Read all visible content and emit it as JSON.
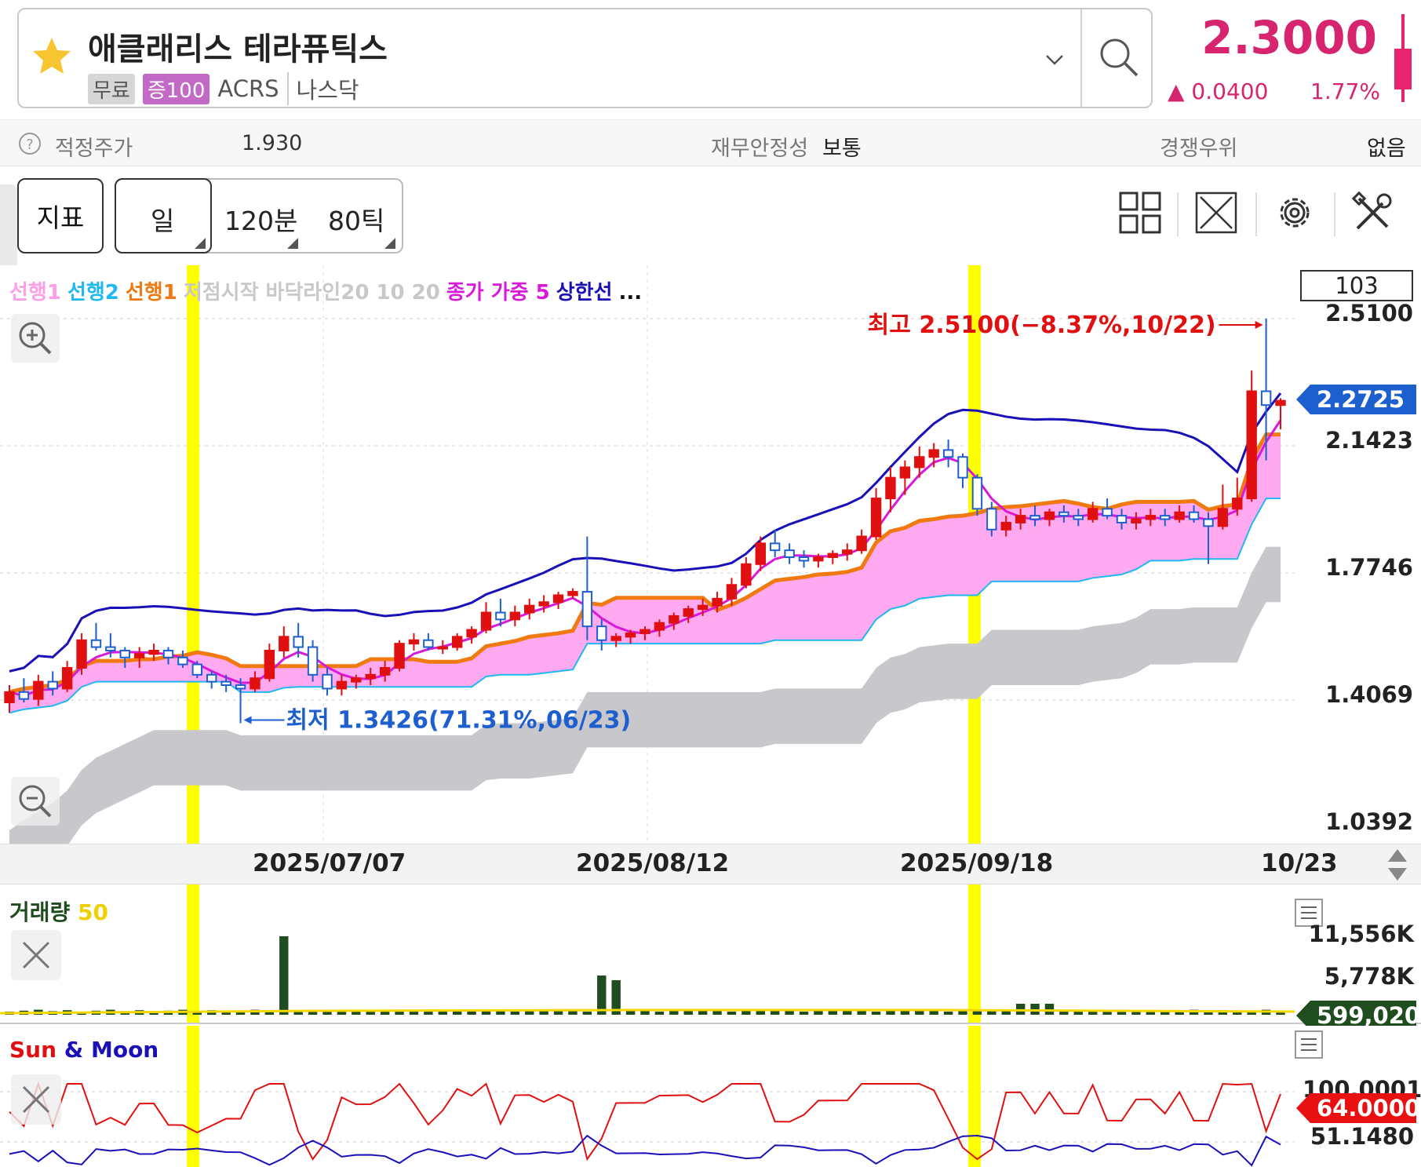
{
  "header": {
    "stock_name": "애클래리스 테라퓨틱스",
    "tag_free": "무료",
    "tag_margin": "증100",
    "ticker": "ACRS",
    "market": "나스닥",
    "price": "2.3000",
    "change": "▲ 0.0400",
    "change_pct": "1.77%",
    "up_color": "#d6246e"
  },
  "valuation": {
    "fair_price_label": "적정주가",
    "fair_price_value": "1.930",
    "stability_label": "재무안정성",
    "stability_value": "보통",
    "advantage_label": "경쟁우위",
    "advantage_value": "없음"
  },
  "toolbar": {
    "indicator_label": "지표",
    "period_day": "일",
    "period_120": "120분",
    "period_80tick": "80틱",
    "icons": [
      "grid-layout-icon",
      "expand-icon",
      "gear-icon",
      "tools-icon"
    ]
  },
  "legend": {
    "items": [
      {
        "text": "선행1",
        "color": "#ff9ee8"
      },
      {
        "text": "선행2",
        "color": "#1fb8f0"
      },
      {
        "text": "선행1",
        "color": "#f07a10"
      },
      {
        "text": "저점시작 바닥라인20 10 20",
        "color": "#c8c8c8"
      },
      {
        "text": "종가 가중 5",
        "color": "#d81ad8"
      },
      {
        "text": "상한선",
        "color": "#1a10b8"
      },
      {
        "text": "...",
        "color": "#111111"
      }
    ]
  },
  "main_chart": {
    "count": "103",
    "y_labels": [
      "2.5100",
      "2.1423",
      "1.7746",
      "1.4069",
      "1.0392"
    ],
    "current_tag": "2.2725",
    "current_tag_color": "#1e5fd0",
    "high_annotation": "최고 2.5100(−8.37%,10/22)",
    "low_annotation": "최저 1.3426(71.31%,06/23)",
    "high_color": "#e01010",
    "low_color": "#1e5fd0",
    "x_labels": [
      "2025/07/07",
      "2025/08/12",
      "2025/09/18",
      "10/23"
    ]
  },
  "volume_panel": {
    "title": "거래량",
    "title_param": "50",
    "y_labels": [
      "11,556K",
      "5,778K"
    ],
    "current_tag": "599,020",
    "current_tag_color": "#1f4d1f"
  },
  "sunmoon_panel": {
    "title_sun": "Sun",
    "title_amp": "&",
    "title_moon": "Moon",
    "y_top": "100.0001",
    "y_mid": "51.1480",
    "current_tag": "64.0000",
    "current_tag_color": "#e81010"
  },
  "chart_data": {
    "type": "candlestick",
    "title": "",
    "xlabel": "",
    "ylabel": "",
    "ylim": [
      1.0392,
      2.51
    ],
    "x_ticks": [
      "2025/07/07",
      "2025/08/12",
      "2025/09/18",
      "10/23"
    ],
    "high": {
      "value": 2.51,
      "date": "10/22",
      "pct": "-8.37%"
    },
    "low": {
      "value": 1.3426,
      "date": "06/23",
      "pct": "71.31%"
    },
    "last_close": 2.2725,
    "candles": [
      {
        "o": 1.4,
        "h": 1.45,
        "l": 1.37,
        "c": 1.43
      },
      {
        "o": 1.43,
        "h": 1.47,
        "l": 1.4,
        "c": 1.41
      },
      {
        "o": 1.41,
        "h": 1.48,
        "l": 1.39,
        "c": 1.46
      },
      {
        "o": 1.46,
        "h": 1.49,
        "l": 1.42,
        "c": 1.44
      },
      {
        "o": 1.44,
        "h": 1.52,
        "l": 1.43,
        "c": 1.5
      },
      {
        "o": 1.5,
        "h": 1.6,
        "l": 1.48,
        "c": 1.58
      },
      {
        "o": 1.58,
        "h": 1.63,
        "l": 1.55,
        "c": 1.56
      },
      {
        "o": 1.56,
        "h": 1.6,
        "l": 1.53,
        "c": 1.55
      },
      {
        "o": 1.55,
        "h": 1.56,
        "l": 1.5,
        "c": 1.53
      },
      {
        "o": 1.53,
        "h": 1.56,
        "l": 1.5,
        "c": 1.54
      },
      {
        "o": 1.54,
        "h": 1.57,
        "l": 1.52,
        "c": 1.55
      },
      {
        "o": 1.55,
        "h": 1.56,
        "l": 1.51,
        "c": 1.53
      },
      {
        "o": 1.53,
        "h": 1.55,
        "l": 1.5,
        "c": 1.51
      },
      {
        "o": 1.51,
        "h": 1.52,
        "l": 1.47,
        "c": 1.48
      },
      {
        "o": 1.48,
        "h": 1.49,
        "l": 1.44,
        "c": 1.46
      },
      {
        "o": 1.46,
        "h": 1.48,
        "l": 1.43,
        "c": 1.45
      },
      {
        "o": 1.45,
        "h": 1.47,
        "l": 1.34,
        "c": 1.44
      },
      {
        "o": 1.44,
        "h": 1.49,
        "l": 1.43,
        "c": 1.47
      },
      {
        "o": 1.47,
        "h": 1.57,
        "l": 1.46,
        "c": 1.55
      },
      {
        "o": 1.55,
        "h": 1.62,
        "l": 1.53,
        "c": 1.59
      },
      {
        "o": 1.59,
        "h": 1.63,
        "l": 1.53,
        "c": 1.56
      },
      {
        "o": 1.56,
        "h": 1.58,
        "l": 1.46,
        "c": 1.48
      },
      {
        "o": 1.48,
        "h": 1.5,
        "l": 1.42,
        "c": 1.44
      },
      {
        "o": 1.44,
        "h": 1.48,
        "l": 1.42,
        "c": 1.46
      },
      {
        "o": 1.46,
        "h": 1.48,
        "l": 1.44,
        "c": 1.47
      },
      {
        "o": 1.47,
        "h": 1.5,
        "l": 1.45,
        "c": 1.48
      },
      {
        "o": 1.48,
        "h": 1.52,
        "l": 1.46,
        "c": 1.5
      },
      {
        "o": 1.5,
        "h": 1.58,
        "l": 1.49,
        "c": 1.57
      },
      {
        "o": 1.57,
        "h": 1.6,
        "l": 1.55,
        "c": 1.58
      },
      {
        "o": 1.58,
        "h": 1.6,
        "l": 1.55,
        "c": 1.56
      },
      {
        "o": 1.56,
        "h": 1.58,
        "l": 1.54,
        "c": 1.56
      },
      {
        "o": 1.56,
        "h": 1.6,
        "l": 1.55,
        "c": 1.59
      },
      {
        "o": 1.59,
        "h": 1.62,
        "l": 1.57,
        "c": 1.61
      },
      {
        "o": 1.61,
        "h": 1.69,
        "l": 1.6,
        "c": 1.66
      },
      {
        "o": 1.66,
        "h": 1.7,
        "l": 1.62,
        "c": 1.64
      },
      {
        "o": 1.64,
        "h": 1.68,
        "l": 1.62,
        "c": 1.66
      },
      {
        "o": 1.66,
        "h": 1.7,
        "l": 1.64,
        "c": 1.68
      },
      {
        "o": 1.68,
        "h": 1.71,
        "l": 1.66,
        "c": 1.69
      },
      {
        "o": 1.69,
        "h": 1.72,
        "l": 1.67,
        "c": 1.71
      },
      {
        "o": 1.71,
        "h": 1.73,
        "l": 1.7,
        "c": 1.72
      },
      {
        "o": 1.72,
        "h": 1.88,
        "l": 1.58,
        "c": 1.62
      },
      {
        "o": 1.62,
        "h": 1.64,
        "l": 1.55,
        "c": 1.58
      },
      {
        "o": 1.58,
        "h": 1.6,
        "l": 1.56,
        "c": 1.59
      },
      {
        "o": 1.59,
        "h": 1.61,
        "l": 1.57,
        "c": 1.6
      },
      {
        "o": 1.6,
        "h": 1.62,
        "l": 1.58,
        "c": 1.61
      },
      {
        "o": 1.61,
        "h": 1.64,
        "l": 1.59,
        "c": 1.63
      },
      {
        "o": 1.63,
        "h": 1.66,
        "l": 1.61,
        "c": 1.65
      },
      {
        "o": 1.65,
        "h": 1.68,
        "l": 1.63,
        "c": 1.67
      },
      {
        "o": 1.67,
        "h": 1.7,
        "l": 1.65,
        "c": 1.68
      },
      {
        "o": 1.68,
        "h": 1.72,
        "l": 1.66,
        "c": 1.7
      },
      {
        "o": 1.7,
        "h": 1.76,
        "l": 1.68,
        "c": 1.74
      },
      {
        "o": 1.74,
        "h": 1.82,
        "l": 1.73,
        "c": 1.8
      },
      {
        "o": 1.8,
        "h": 1.88,
        "l": 1.78,
        "c": 1.86
      },
      {
        "o": 1.86,
        "h": 1.9,
        "l": 1.82,
        "c": 1.84
      },
      {
        "o": 1.84,
        "h": 1.86,
        "l": 1.8,
        "c": 1.82
      },
      {
        "o": 1.82,
        "h": 1.84,
        "l": 1.79,
        "c": 1.81
      },
      {
        "o": 1.81,
        "h": 1.83,
        "l": 1.79,
        "c": 1.82
      },
      {
        "o": 1.82,
        "h": 1.84,
        "l": 1.8,
        "c": 1.83
      },
      {
        "o": 1.83,
        "h": 1.86,
        "l": 1.81,
        "c": 1.84
      },
      {
        "o": 1.84,
        "h": 1.9,
        "l": 1.83,
        "c": 1.88
      },
      {
        "o": 1.88,
        "h": 2.02,
        "l": 1.87,
        "c": 1.99
      },
      {
        "o": 1.99,
        "h": 2.08,
        "l": 1.95,
        "c": 2.05
      },
      {
        "o": 2.05,
        "h": 2.1,
        "l": 2.0,
        "c": 2.08
      },
      {
        "o": 2.08,
        "h": 2.14,
        "l": 2.05,
        "c": 2.11
      },
      {
        "o": 2.11,
        "h": 2.15,
        "l": 2.08,
        "c": 2.13
      },
      {
        "o": 2.13,
        "h": 2.16,
        "l": 2.08,
        "c": 2.11
      },
      {
        "o": 2.11,
        "h": 2.12,
        "l": 2.02,
        "c": 2.05
      },
      {
        "o": 2.05,
        "h": 2.06,
        "l": 1.94,
        "c": 1.96
      },
      {
        "o": 1.96,
        "h": 1.98,
        "l": 1.88,
        "c": 1.9
      },
      {
        "o": 1.9,
        "h": 1.94,
        "l": 1.88,
        "c": 1.92
      },
      {
        "o": 1.92,
        "h": 1.96,
        "l": 1.9,
        "c": 1.94
      },
      {
        "o": 1.94,
        "h": 1.97,
        "l": 1.91,
        "c": 1.93
      },
      {
        "o": 1.93,
        "h": 1.96,
        "l": 1.91,
        "c": 1.95
      },
      {
        "o": 1.95,
        "h": 1.97,
        "l": 1.92,
        "c": 1.94
      },
      {
        "o": 1.94,
        "h": 1.96,
        "l": 1.91,
        "c": 1.93
      },
      {
        "o": 1.93,
        "h": 1.98,
        "l": 1.92,
        "c": 1.96
      },
      {
        "o": 1.96,
        "h": 1.99,
        "l": 1.93,
        "c": 1.94
      },
      {
        "o": 1.94,
        "h": 1.96,
        "l": 1.9,
        "c": 1.92
      },
      {
        "o": 1.92,
        "h": 1.95,
        "l": 1.9,
        "c": 1.93
      },
      {
        "o": 1.93,
        "h": 1.96,
        "l": 1.91,
        "c": 1.94
      },
      {
        "o": 1.94,
        "h": 1.96,
        "l": 1.91,
        "c": 1.93
      },
      {
        "o": 1.93,
        "h": 1.97,
        "l": 1.92,
        "c": 1.95
      },
      {
        "o": 1.95,
        "h": 1.97,
        "l": 1.92,
        "c": 1.93
      },
      {
        "o": 1.93,
        "h": 1.95,
        "l": 1.8,
        "c": 1.91
      },
      {
        "o": 1.91,
        "h": 2.03,
        "l": 1.9,
        "c": 1.96
      },
      {
        "o": 1.96,
        "h": 2.05,
        "l": 1.94,
        "c": 1.99
      },
      {
        "o": 1.99,
        "h": 2.36,
        "l": 1.98,
        "c": 2.3
      },
      {
        "o": 2.3,
        "h": 2.51,
        "l": 2.1,
        "c": 2.26
      },
      {
        "o": 2.26,
        "h": 2.28,
        "l": 2.19,
        "c": 2.2725
      }
    ]
  }
}
